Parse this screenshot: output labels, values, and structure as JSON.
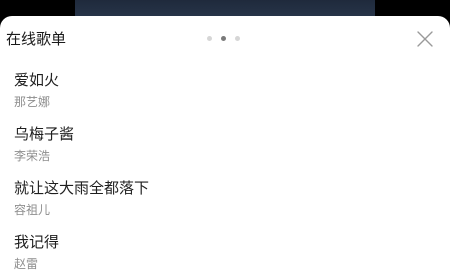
{
  "sheet": {
    "title": "在线歌单",
    "pager": {
      "count": 3,
      "active": 2
    },
    "close_icon": "close-icon"
  },
  "songs": [
    {
      "title": "爱如火",
      "artist": "那艺娜"
    },
    {
      "title": "乌梅子酱",
      "artist": "李荣浩"
    },
    {
      "title": "就让这大雨全都落下",
      "artist": "容祖儿"
    },
    {
      "title": "我记得",
      "artist": "赵雷"
    }
  ],
  "colors": {
    "title_text": "#1f1f1f",
    "artist_text": "#8e8e8e",
    "dot_active": "#7a7a7a",
    "dot_inactive": "#d6d6d6"
  }
}
